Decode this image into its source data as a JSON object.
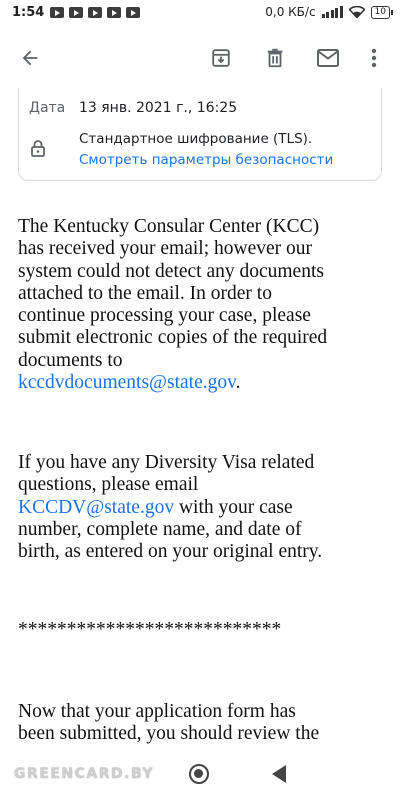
{
  "status_bar": {
    "time": "1:54",
    "network_speed": "0,0 КБ/с",
    "battery": "10"
  },
  "toolbar": {
    "back_icon": "arrow-back-icon",
    "archive_icon": "archive-icon",
    "delete_icon": "trash-icon",
    "unread_icon": "mail-icon",
    "more_icon": "more-vert-icon"
  },
  "details": {
    "date_label": "Дата",
    "date_value": "13 янв. 2021 г., 16:25",
    "encryption": "Стандартное шифрование (TLS).",
    "security_link": "Смотреть параметры безопасности"
  },
  "email": {
    "p1_lines": [
      "The Kentucky Consular Center (KCC)",
      "has received your email; however our",
      "system could not detect any documents",
      "attached to the email. In order to",
      "continue processing your case, please",
      "submit electronic copies of the required",
      "documents to"
    ],
    "p1_link": "kccdvdocuments@state.gov",
    "p1_end": ".",
    "p2_line1": "If you have any Diversity Visa related",
    "p2_line2": "questions, please email",
    "p2_link": "KCCDV@state.gov",
    "p2_line3_rest": " with your case",
    "p2_line4": "number, complete name, and date of",
    "p2_line5": "birth, as entered on your original entry.",
    "separator": "***************************",
    "p3_line1": "Now that your application form has",
    "p3_line2": "been submitted, you should review the"
  },
  "nav": {
    "watermark": "GREENCARD.BY"
  },
  "colors": {
    "link": "#1a73e8",
    "text": "#111111",
    "muted": "#5f6368"
  }
}
